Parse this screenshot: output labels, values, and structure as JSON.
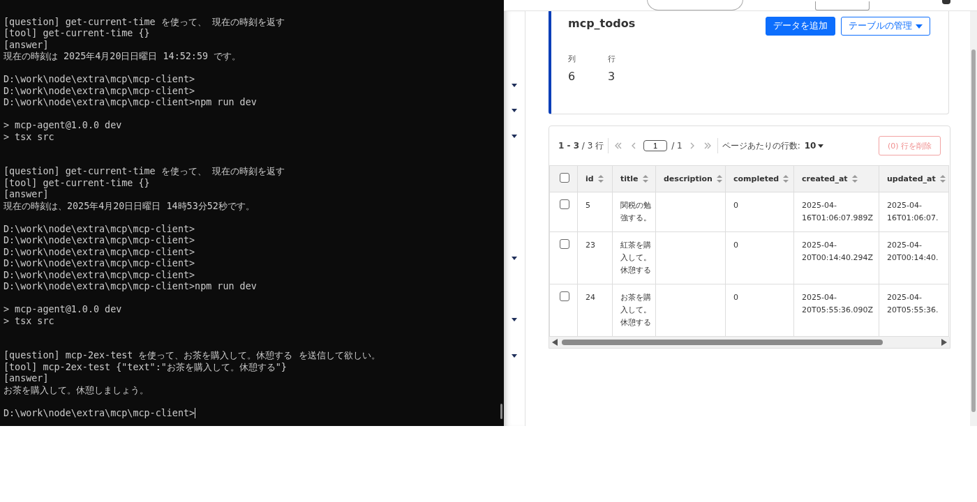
{
  "terminal": {
    "lines": [
      {
        "kind": "blank"
      },
      {
        "kind": "text",
        "text": "[question] get-current-time を使って、 現在の時刻を返す"
      },
      {
        "kind": "text",
        "text": "[tool] get-current-time {}"
      },
      {
        "kind": "text",
        "text": "[answer]"
      },
      {
        "kind": "text",
        "text": "現在の時刻は 2025年4月20日日曜日 14:52:59 です。"
      },
      {
        "kind": "blank"
      },
      {
        "kind": "text",
        "text": "D:\\work\\node\\extra\\mcp\\mcp-client>"
      },
      {
        "kind": "text",
        "text": "D:\\work\\node\\extra\\mcp\\mcp-client>"
      },
      {
        "kind": "text",
        "text": "D:\\work\\node\\extra\\mcp\\mcp-client>npm run dev"
      },
      {
        "kind": "blank"
      },
      {
        "kind": "text",
        "text": "> mcp-agent@1.0.0 dev"
      },
      {
        "kind": "text",
        "text": "> tsx src"
      },
      {
        "kind": "blank"
      },
      {
        "kind": "blank"
      },
      {
        "kind": "text",
        "text": "[question] get-current-time を使って、 現在の時刻を返す"
      },
      {
        "kind": "text",
        "text": "[tool] get-current-time {}"
      },
      {
        "kind": "text",
        "text": "[answer]"
      },
      {
        "kind": "text",
        "text": "現在の時刻は、2025年4月20日日曜日 14時53分52秒です。"
      },
      {
        "kind": "blank"
      },
      {
        "kind": "text",
        "text": "D:\\work\\node\\extra\\mcp\\mcp-client>"
      },
      {
        "kind": "text",
        "text": "D:\\work\\node\\extra\\mcp\\mcp-client>"
      },
      {
        "kind": "text",
        "text": "D:\\work\\node\\extra\\mcp\\mcp-client>"
      },
      {
        "kind": "text",
        "text": "D:\\work\\node\\extra\\mcp\\mcp-client>"
      },
      {
        "kind": "text",
        "text": "D:\\work\\node\\extra\\mcp\\mcp-client>"
      },
      {
        "kind": "text",
        "text": "D:\\work\\node\\extra\\mcp\\mcp-client>npm run dev"
      },
      {
        "kind": "blank"
      },
      {
        "kind": "text",
        "text": "> mcp-agent@1.0.0 dev"
      },
      {
        "kind": "text",
        "text": "> tsx src"
      },
      {
        "kind": "blank"
      },
      {
        "kind": "blank"
      },
      {
        "kind": "text",
        "text": "[question] mcp-2ex-test を使って、お茶を購入して。休憩する を送信して欲しい。"
      },
      {
        "kind": "text",
        "text": "[tool] mcp-2ex-test {\"text\":\"お茶を購入して。休憩する\"}"
      },
      {
        "kind": "text",
        "text": "[answer]"
      },
      {
        "kind": "text",
        "text": "お茶を購入して。休憩しましょう。"
      },
      {
        "kind": "blank"
      },
      {
        "kind": "prompt",
        "text": "D:\\work\\node\\extra\\mcp\\mcp-client>"
      }
    ]
  },
  "table_card": {
    "title": "mcp_todos",
    "actions": [
      {
        "label": "データを追加",
        "kind": "primary"
      },
      {
        "label": "テーブルの管理",
        "kind": "dropdown"
      }
    ],
    "stats": [
      {
        "label": "列",
        "value": "6"
      },
      {
        "label": "行",
        "value": "3"
      }
    ]
  },
  "table": {
    "range": "**1 - 3** / 3 行",
    "page": "1",
    "pages": "/ 1",
    "rows_per_page_label": "ページあたりの行数:",
    "rows_per_page": "10",
    "delete_button": {
      "label": "(0) 行を削除",
      "disabled": true
    },
    "all_selected": false,
    "columns": [
      "id",
      "title",
      "description",
      "completed",
      "created_at",
      "updated_at"
    ],
    "rows": [
      {
        "selected": false,
        "cells": [
          "5",
          "関税の勉強する。",
          null,
          "0",
          "2025-04-16T01:06:07.989Z",
          "2025-04-16T01:06:07."
        ]
      },
      {
        "selected": false,
        "cells": [
          "23",
          "紅茶を購入して。休憩する",
          null,
          "0",
          "2025-04-20T00:14:40.294Z",
          "2025-04-20T00:14:40."
        ]
      },
      {
        "selected": false,
        "cells": [
          "24",
          "お茶を購入して。休憩する",
          null,
          "0",
          "2025-04-20T05:55:36.090Z",
          "2025-04-20T05:55:36."
        ]
      }
    ]
  }
}
